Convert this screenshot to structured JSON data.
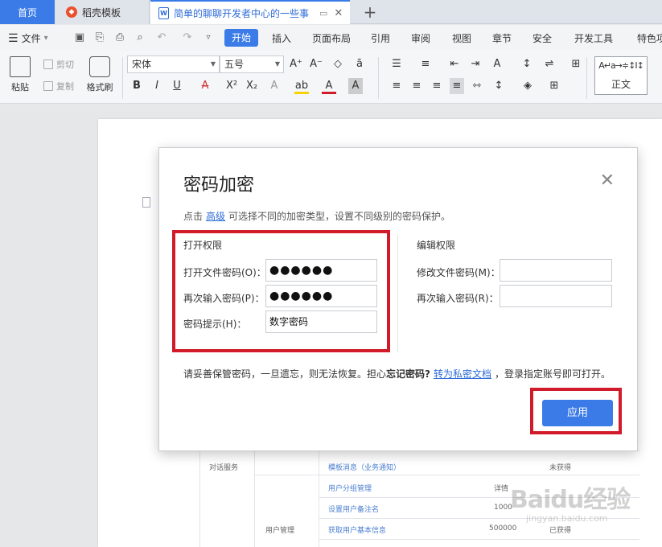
{
  "tabs": {
    "home": "首页",
    "template": "稻壳模板",
    "document": "简单的聊聊开发者中心的一些事"
  },
  "menu": {
    "file": "文件",
    "start": "开始",
    "items": [
      "插入",
      "页面布局",
      "引用",
      "审阅",
      "视图",
      "章节",
      "安全",
      "开发工具",
      "特色项"
    ]
  },
  "ribbon": {
    "paste": "粘贴",
    "cut": "剪切",
    "copy": "复制",
    "format_painter": "格式刷",
    "font_name": "宋体",
    "font_size": "五号",
    "style_normal": "正文",
    "style_preview": "A↵a→≑↕I↕"
  },
  "dialog": {
    "title": "密码加密",
    "desc_prefix": "点击",
    "desc_link": "高级",
    "desc_suffix": "可选择不同的加密类型，设置不同级别的密码保护。",
    "open_section": "打开权限",
    "open_pwd_label": "打开文件密码(O)：",
    "open_pwd_value": "●●●●●●",
    "reenter_label": "再次输入密码(P)：",
    "reenter_value": "●●●●●●",
    "hint_label": "密码提示(H)：",
    "hint_value": "数字密码",
    "edit_section": "编辑权限",
    "edit_pwd_label": "修改文件密码(M)：",
    "edit_reenter_label": "再次输入密码(R)：",
    "warn_prefix": "请妥善保管密码，一旦遗忘，则无法恢复。担心",
    "warn_bold": "忘记密码?",
    "warn_link": "转为私密文档",
    "warn_suffix": "，登录指定账号即可打开。",
    "apply": "应用"
  },
  "doc_table": {
    "row1_cat": "对话服务",
    "row1_item": "模板消息（业务通知）",
    "row1_status": "未获得",
    "row2_item": "用户分组管理",
    "row2_detail": "详情",
    "row3_item": "设置用户备注名",
    "row3_value": "1000",
    "row4_cat": "用户管理",
    "row4_item": "获取用户基本信息",
    "row4_value": "500000",
    "row4_status": "已获得"
  },
  "watermark": {
    "main": "Baidu经验",
    "sub": "jingyan.baidu.com"
  },
  "colors": {
    "accent": "#3b7be8",
    "highlight": "#d11a2a",
    "link": "#2d6bd8"
  }
}
